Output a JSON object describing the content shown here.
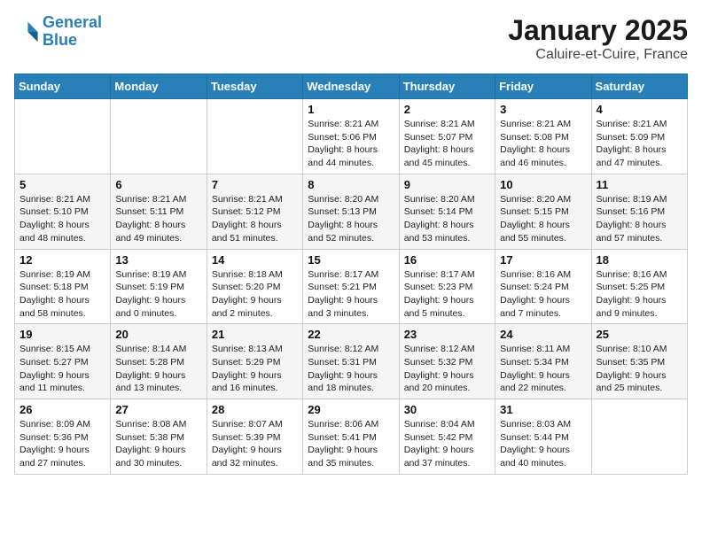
{
  "header": {
    "logo_line1": "General",
    "logo_line2": "Blue",
    "title": "January 2025",
    "subtitle": "Caluire-et-Cuire, France"
  },
  "weekdays": [
    "Sunday",
    "Monday",
    "Tuesday",
    "Wednesday",
    "Thursday",
    "Friday",
    "Saturday"
  ],
  "weeks": [
    [
      {
        "day": "",
        "info": ""
      },
      {
        "day": "",
        "info": ""
      },
      {
        "day": "",
        "info": ""
      },
      {
        "day": "1",
        "info": "Sunrise: 8:21 AM\nSunset: 5:06 PM\nDaylight: 8 hours and 44 minutes."
      },
      {
        "day": "2",
        "info": "Sunrise: 8:21 AM\nSunset: 5:07 PM\nDaylight: 8 hours and 45 minutes."
      },
      {
        "day": "3",
        "info": "Sunrise: 8:21 AM\nSunset: 5:08 PM\nDaylight: 8 hours and 46 minutes."
      },
      {
        "day": "4",
        "info": "Sunrise: 8:21 AM\nSunset: 5:09 PM\nDaylight: 8 hours and 47 minutes."
      }
    ],
    [
      {
        "day": "5",
        "info": "Sunrise: 8:21 AM\nSunset: 5:10 PM\nDaylight: 8 hours and 48 minutes."
      },
      {
        "day": "6",
        "info": "Sunrise: 8:21 AM\nSunset: 5:11 PM\nDaylight: 8 hours and 49 minutes."
      },
      {
        "day": "7",
        "info": "Sunrise: 8:21 AM\nSunset: 5:12 PM\nDaylight: 8 hours and 51 minutes."
      },
      {
        "day": "8",
        "info": "Sunrise: 8:20 AM\nSunset: 5:13 PM\nDaylight: 8 hours and 52 minutes."
      },
      {
        "day": "9",
        "info": "Sunrise: 8:20 AM\nSunset: 5:14 PM\nDaylight: 8 hours and 53 minutes."
      },
      {
        "day": "10",
        "info": "Sunrise: 8:20 AM\nSunset: 5:15 PM\nDaylight: 8 hours and 55 minutes."
      },
      {
        "day": "11",
        "info": "Sunrise: 8:19 AM\nSunset: 5:16 PM\nDaylight: 8 hours and 57 minutes."
      }
    ],
    [
      {
        "day": "12",
        "info": "Sunrise: 8:19 AM\nSunset: 5:18 PM\nDaylight: 8 hours and 58 minutes."
      },
      {
        "day": "13",
        "info": "Sunrise: 8:19 AM\nSunset: 5:19 PM\nDaylight: 9 hours and 0 minutes."
      },
      {
        "day": "14",
        "info": "Sunrise: 8:18 AM\nSunset: 5:20 PM\nDaylight: 9 hours and 2 minutes."
      },
      {
        "day": "15",
        "info": "Sunrise: 8:17 AM\nSunset: 5:21 PM\nDaylight: 9 hours and 3 minutes."
      },
      {
        "day": "16",
        "info": "Sunrise: 8:17 AM\nSunset: 5:23 PM\nDaylight: 9 hours and 5 minutes."
      },
      {
        "day": "17",
        "info": "Sunrise: 8:16 AM\nSunset: 5:24 PM\nDaylight: 9 hours and 7 minutes."
      },
      {
        "day": "18",
        "info": "Sunrise: 8:16 AM\nSunset: 5:25 PM\nDaylight: 9 hours and 9 minutes."
      }
    ],
    [
      {
        "day": "19",
        "info": "Sunrise: 8:15 AM\nSunset: 5:27 PM\nDaylight: 9 hours and 11 minutes."
      },
      {
        "day": "20",
        "info": "Sunrise: 8:14 AM\nSunset: 5:28 PM\nDaylight: 9 hours and 13 minutes."
      },
      {
        "day": "21",
        "info": "Sunrise: 8:13 AM\nSunset: 5:29 PM\nDaylight: 9 hours and 16 minutes."
      },
      {
        "day": "22",
        "info": "Sunrise: 8:12 AM\nSunset: 5:31 PM\nDaylight: 9 hours and 18 minutes."
      },
      {
        "day": "23",
        "info": "Sunrise: 8:12 AM\nSunset: 5:32 PM\nDaylight: 9 hours and 20 minutes."
      },
      {
        "day": "24",
        "info": "Sunrise: 8:11 AM\nSunset: 5:34 PM\nDaylight: 9 hours and 22 minutes."
      },
      {
        "day": "25",
        "info": "Sunrise: 8:10 AM\nSunset: 5:35 PM\nDaylight: 9 hours and 25 minutes."
      }
    ],
    [
      {
        "day": "26",
        "info": "Sunrise: 8:09 AM\nSunset: 5:36 PM\nDaylight: 9 hours and 27 minutes."
      },
      {
        "day": "27",
        "info": "Sunrise: 8:08 AM\nSunset: 5:38 PM\nDaylight: 9 hours and 30 minutes."
      },
      {
        "day": "28",
        "info": "Sunrise: 8:07 AM\nSunset: 5:39 PM\nDaylight: 9 hours and 32 minutes."
      },
      {
        "day": "29",
        "info": "Sunrise: 8:06 AM\nSunset: 5:41 PM\nDaylight: 9 hours and 35 minutes."
      },
      {
        "day": "30",
        "info": "Sunrise: 8:04 AM\nSunset: 5:42 PM\nDaylight: 9 hours and 37 minutes."
      },
      {
        "day": "31",
        "info": "Sunrise: 8:03 AM\nSunset: 5:44 PM\nDaylight: 9 hours and 40 minutes."
      },
      {
        "day": "",
        "info": ""
      }
    ]
  ]
}
